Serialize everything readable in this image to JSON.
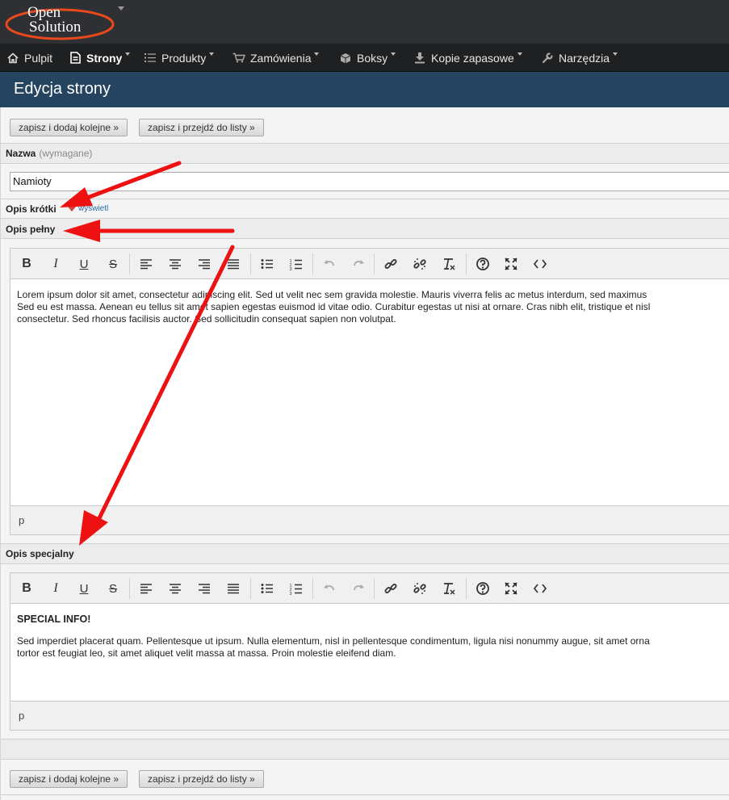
{
  "logo": {
    "line1": "Open",
    "line2": "Solution"
  },
  "menu": [
    {
      "label": "Pulpit",
      "icon": "home-icon"
    },
    {
      "label": "Strony",
      "icon": "document-icon"
    },
    {
      "label": "Produkty",
      "icon": "list-icon"
    },
    {
      "label": "Zamówienia",
      "icon": "cart-icon"
    },
    {
      "label": "Boksy",
      "icon": "box-icon"
    },
    {
      "label": "Kopie zapasowe",
      "icon": "download-icon"
    },
    {
      "label": "Narzędzia",
      "icon": "wrench-icon"
    }
  ],
  "page": {
    "title": "Edycja strony"
  },
  "buttons": {
    "save_add": "zapisz i dodaj kolejne »",
    "save_list": "zapisz i przejdź do listy »"
  },
  "fields": {
    "name_label": "Nazwa",
    "name_required": "(wymagane)",
    "name_value": "Namioty",
    "short_label": "Opis krótki",
    "short_toggle": "wyświetl",
    "full_label": "Opis pełny",
    "special_label": "Opis specjalny"
  },
  "editor_full": {
    "lines": [
      "Lorem ipsum dolor sit amet, consectetur adipiscing elit. Sed ut velit nec sem gravida molestie. Mauris viverra felis ac metus interdum, sed maximus",
      "Sed eu est massa. Aenean eu tellus sit amet sapien egestas euismod id vitae odio. Curabitur egestas ut nisi at ornare. Cras nibh elit, tristique et nisl",
      "consectetur. Sed rhoncus facilisis auctor. Sed sollicitudin consequat sapien non volutpat."
    ],
    "status": "p"
  },
  "editor_special": {
    "heading": "SPECIAL INFO!",
    "lines": [
      "Sed imperdiet placerat quam. Pellentesque ut ipsum. Nulla elementum, nisl in pellentesque condimentum, ligula nisi nonummy augue, sit amet orna",
      "tortor est feugiat leo, sit amet aliquet velit massa at massa. Proin molestie eleifend diam."
    ],
    "status": "p"
  },
  "toolbar_buttons": [
    {
      "name": "bold-button",
      "glyph": "B"
    },
    {
      "name": "italic-button",
      "glyph": "I"
    },
    {
      "name": "underline-button",
      "glyph": "U"
    },
    {
      "name": "strikethrough-button",
      "glyph": "S"
    },
    {
      "name": "align-left-button",
      "icon": "align-left-icon"
    },
    {
      "name": "align-center-button",
      "icon": "align-center-icon"
    },
    {
      "name": "align-right-button",
      "icon": "align-right-icon"
    },
    {
      "name": "align-justify-button",
      "icon": "align-justify-icon"
    },
    {
      "name": "bullet-list-button",
      "icon": "bullet-list-icon"
    },
    {
      "name": "numbered-list-button",
      "icon": "numbered-list-icon"
    },
    {
      "name": "undo-button",
      "icon": "undo-icon"
    },
    {
      "name": "redo-button",
      "icon": "redo-icon"
    },
    {
      "name": "link-button",
      "icon": "link-icon"
    },
    {
      "name": "unlink-button",
      "icon": "unlink-icon"
    },
    {
      "name": "clear-format-button",
      "icon": "clear-format-icon"
    },
    {
      "name": "help-button",
      "icon": "help-icon"
    },
    {
      "name": "fullscreen-button",
      "icon": "fullscreen-icon"
    },
    {
      "name": "source-code-button",
      "icon": "code-icon"
    }
  ],
  "colors": {
    "header": "#2f3033",
    "menu": "#1f2022",
    "title_band": "#25445f",
    "arrow": "#ee1111",
    "toggle_triangle": "#d6403a",
    "link": "#2a6aa8"
  }
}
